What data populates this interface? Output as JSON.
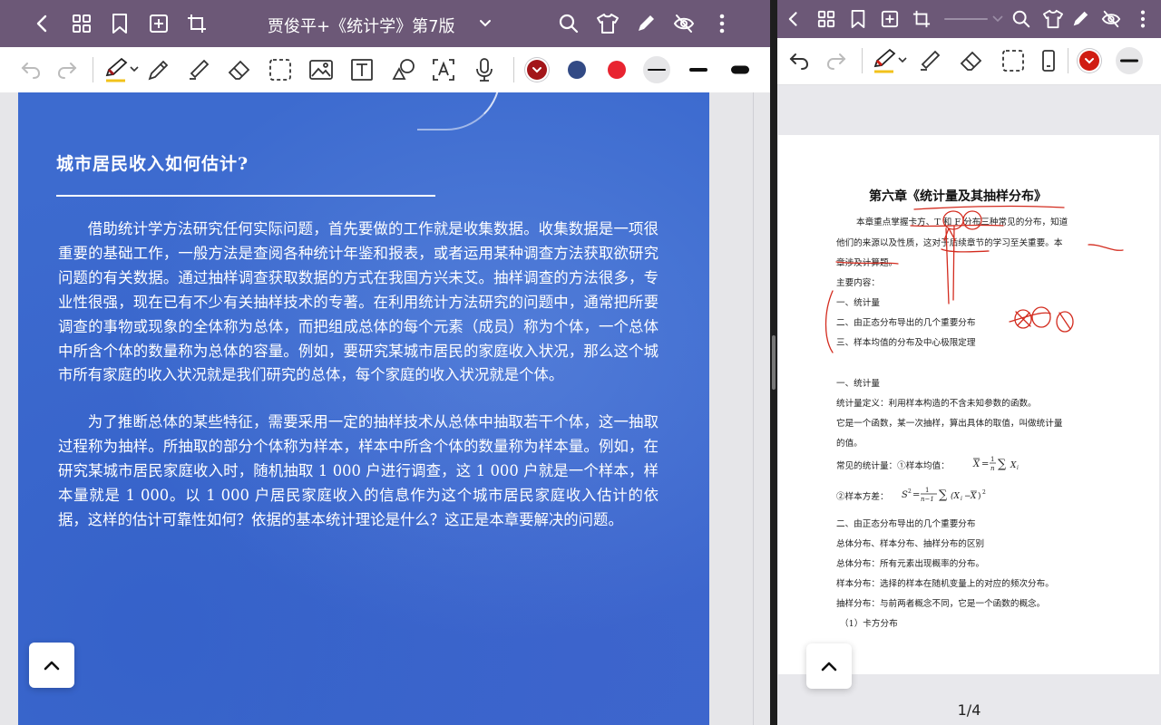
{
  "colors": {
    "topbar": "#6c5877",
    "book_page": "#3d6bcf",
    "pen_dark_red": "#a3161a",
    "pen_navy": "#324a85",
    "pen_red": "#e82430",
    "annotation_ink": "#d32b1e"
  },
  "left": {
    "title": "贾俊平+《统计学》第7版",
    "topbar_icons": [
      "back-icon",
      "grid-icon",
      "bookmark-icon",
      "add-page-icon",
      "crop-icon",
      "title-dropdown-icon",
      "search-icon",
      "shirt-icon",
      "pen-icon",
      "eye-off-icon",
      "more-icon"
    ],
    "tools": [
      "undo-icon",
      "redo-icon",
      "pen-tool-icon",
      "pencil-icon",
      "highlighter-icon",
      "eraser-icon",
      "lasso-select-icon",
      "image-icon",
      "text-box-icon",
      "shape-icon",
      "ocr-text-icon",
      "microphone-icon"
    ],
    "swatches": [
      "#a3161a",
      "#324a85",
      "#e82430"
    ],
    "book": {
      "heading": "城市居民收入如何估计?",
      "paragraphs": [
        "借助统计学方法研究任何实际问题，首先要做的工作就是收集数据。收集数据是一项很重要的基础工作，一般方法是查阅各种统计年鉴和报表，或者运用某种调查方法获取欲研究问题的有关数据。通过抽样调查获取数据的方式在我国方兴未艾。抽样调查的方法很多，专业性很强，现在已有不少有关抽样技术的专著。在利用统计方法研究的问题中，通常把所要调查的事物或现象的全体称为总体，而把组成总体的每个元素（成员）称为个体，一个总体中所含个体的数量称为总体的容量。例如，要研究某城市居民的家庭收入状况，那么这个城市所有家庭的收入状况就是我们研究的总体，每个家庭的收入状况就是个体。",
        "为了推断总体的某些特征，需要采用一定的抽样技术从总体中抽取若干个体，这一抽取过程称为抽样。所抽取的部分个体称为样本，样本中所含个体的数量称为样本量。例如，在研究某城市居民家庭收入时，随机抽取 1 000 户进行调查，这 1 000 户就是一个样本，样本量就是 1 000。以 1 000 户居民家庭收入的信息作为这个城市居民家庭收入估计的依据，这样的估计可靠性如何？依据的基本统计理论是什么？这正是本章要解决的问题。"
      ]
    }
  },
  "right": {
    "topbar_icons": [
      "back-icon",
      "grid-icon",
      "bookmark-icon",
      "add-page-icon",
      "crop-icon",
      "search-icon",
      "shirt-icon",
      "pen-icon",
      "eye-off-icon",
      "more-icon"
    ],
    "tools": [
      "undo-icon",
      "redo-icon",
      "pen-tool-icon",
      "highlighter-icon",
      "eraser-icon",
      "lasso-select-icon",
      "phone-icon"
    ],
    "swatch": "#d01c12",
    "page_indicator": "1/4",
    "note": {
      "title": "第六章《统计量及其抽样分布》",
      "lines": [
        "本章重点掌握卡方、T 和 F 分布三种常见的分布，知道",
        "他们的来源以及性质，这对于后续章节的学习至关重要。本",
        "章涉及计算题。",
        "主要内容：",
        "一、统计量",
        "二、由正态分布导出的几个重要分布",
        "三、样本均值的分布及中心极限定理",
        "一、统计量",
        "统计量定义：利用样本构造的不含未知参数的函数。",
        "它是一个函数，某一次抽样，算出具体的取值，叫做统计量",
        "的值。",
        "常见的统计量：①样本均值：",
        "②样本方差：",
        "二、由正态分布导出的几个重要分布",
        "总体分布、样本分布、抽样分布的区别",
        "总体分布：所有元素出现概率的分布。",
        "样本分布：选择的样本在随机变量上的对应的频次分布。",
        "抽样分布：与前两者概念不同，它是一个函数的概念。",
        "（1）卡方分布"
      ]
    }
  }
}
